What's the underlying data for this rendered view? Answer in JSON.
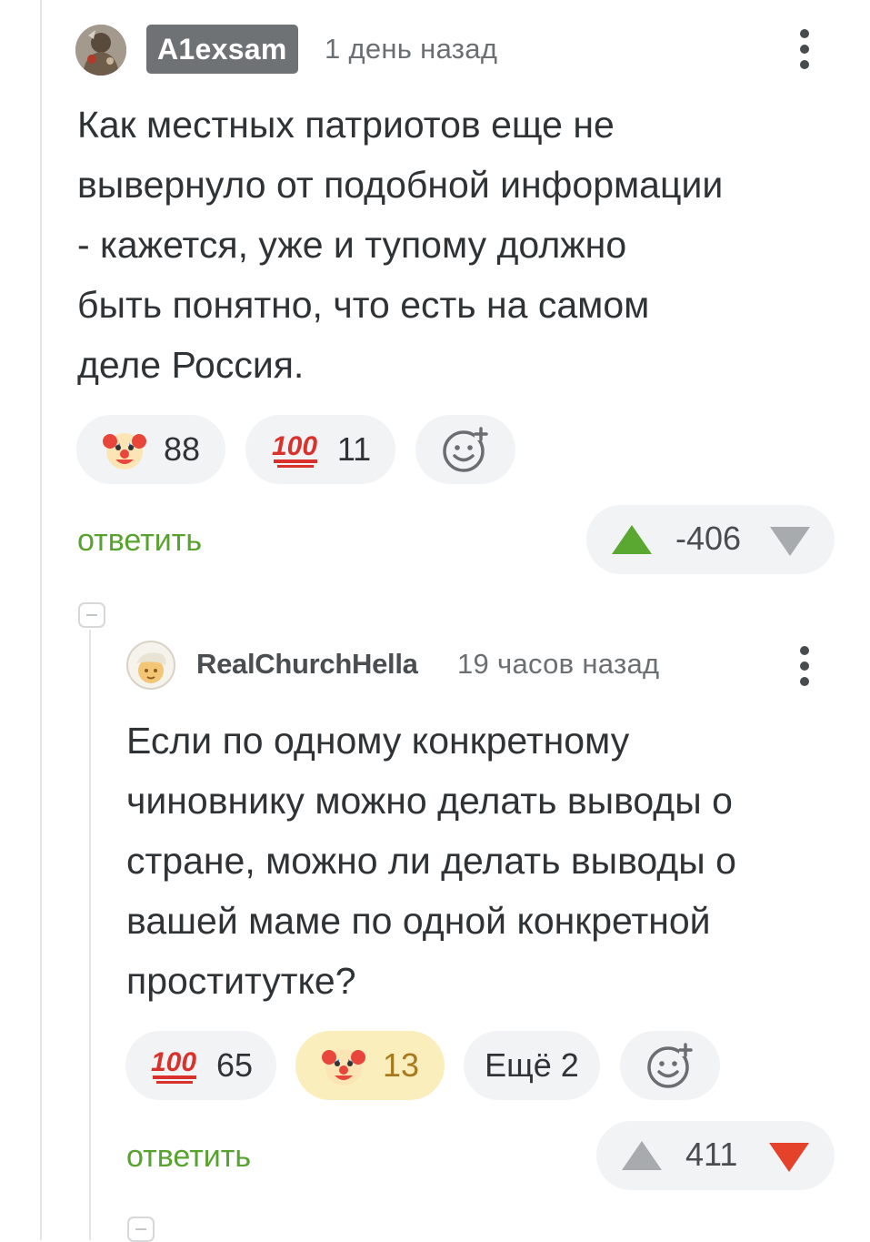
{
  "comment1": {
    "username": "A1exsam",
    "timestamp": "1 день назад",
    "text_lines": [
      "Как местных патриотов еще не",
      "вывернуло от подобной информации",
      "- кажется, уже и тупому должно",
      "быть понятно, что есть на самом",
      "деле Россия."
    ],
    "reactions": [
      {
        "icon": "clown-face-icon",
        "count": "88"
      },
      {
        "icon": "hundred-points-icon",
        "count": "11"
      }
    ],
    "add_reaction_icon": "add-reaction-icon",
    "reply_label": "ответить",
    "rating": "-406",
    "upvote_color": "#5aa832",
    "downvote_color": "#a8abae"
  },
  "comment2": {
    "username": "RealChurchHella",
    "timestamp": "19 часов назад",
    "text_lines": [
      "Если по одному конкретному",
      "чиновнику можно делать выводы о",
      "стране, можно ли делать выводы о",
      "вашей маме по одной конкретной",
      "проститутке?"
    ],
    "reactions": [
      {
        "icon": "hundred-points-icon",
        "count": "65"
      },
      {
        "icon": "clown-face-icon",
        "count": "13",
        "active": true
      }
    ],
    "more_label": "Ещё 2",
    "add_reaction_icon": "add-reaction-icon",
    "reply_label": "ответить",
    "rating": "411",
    "upvote_color": "#a8abae",
    "downvote_color": "#e5422c"
  },
  "colors": {
    "accent_green": "#57a32d",
    "badge_bg": "#6f7275",
    "pill_bg": "#f2f3f5",
    "active_pill_bg": "#fbeebd"
  }
}
